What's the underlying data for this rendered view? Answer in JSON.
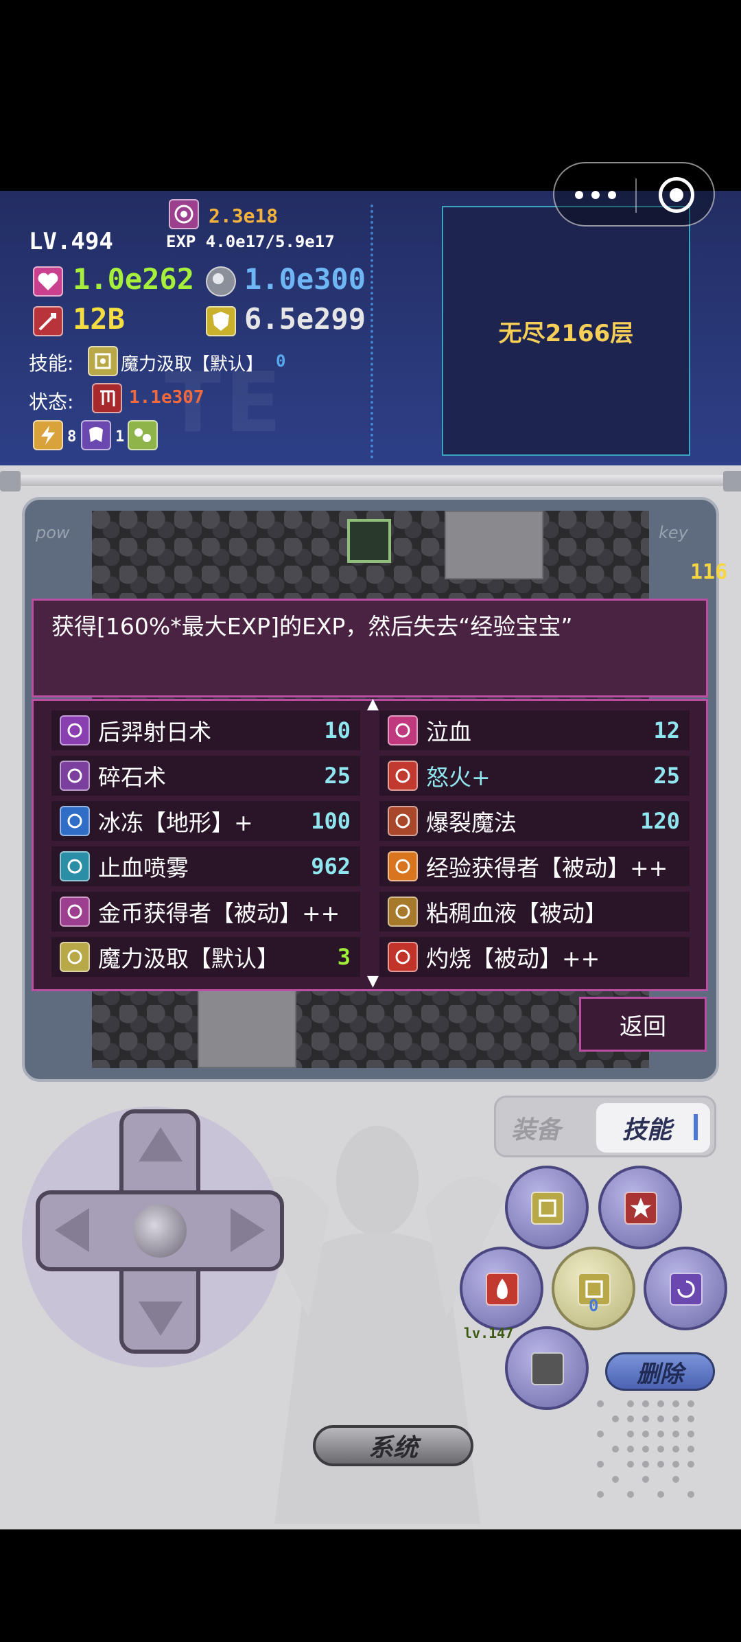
{
  "hud": {
    "level": "LV.494",
    "exp": "EXP 4.0e17/5.9e17",
    "gold": "2.3e18",
    "hp": "1.0e262",
    "defense": "1.0e300",
    "attack": "12B",
    "mdef": "6.5e299",
    "skill_label": "技能:",
    "skill_name": "魔力汲取【默认】",
    "skill_count": "0",
    "status_label": "状态:",
    "status_value": "1.1e307",
    "badge_a": "8",
    "badge_b": "1",
    "watermark": "TE",
    "floor": "无尽2166层"
  },
  "board": {
    "pow_label": "pow",
    "key_label": "key",
    "key_count": "116"
  },
  "description": "获得[160%*最大EXP]的EXP，然后失去“经验宝宝”",
  "skills": [
    {
      "name": "后羿射日术",
      "value": "10",
      "icon": "arrow-skill-icon",
      "color": "#8a3fb0"
    },
    {
      "name": "泣血",
      "value": "12",
      "icon": "blood-drop-icon",
      "color": "#c0397e"
    },
    {
      "name": "碎石术",
      "value": "25",
      "icon": "rock-shatter-icon",
      "color": "#7b3f9e"
    },
    {
      "name": "怒火+",
      "value": "25",
      "icon": "flame-icon",
      "color": "#c23a2f"
    },
    {
      "name": "冰冻【地形】+",
      "value": "100",
      "icon": "snowflake-icon",
      "color": "#2f6dc6"
    },
    {
      "name": "爆裂魔法",
      "value": "120",
      "icon": "explosion-icon",
      "color": "#a9472b"
    },
    {
      "name": "止血喷雾",
      "value": "962",
      "icon": "spray-icon",
      "color": "#2a8fa6"
    },
    {
      "name": "经验获得者【被动】++",
      "value": "",
      "icon": "exp-icon",
      "color": "#d9741f"
    },
    {
      "name": "金币获得者【被动】++",
      "value": "",
      "icon": "coin-spiral-icon",
      "color": "#9b3f8e"
    },
    {
      "name": "粘稠血液【被动】",
      "value": "",
      "icon": "blood-swirl-icon",
      "color": "#a67a2a"
    },
    {
      "name": "魔力汲取【默认】",
      "value": "3",
      "icon": "mana-drain-icon",
      "color": "#b8a848"
    },
    {
      "name": "灼烧【被动】++",
      "value": "",
      "icon": "burn-icon",
      "color": "#c2342a"
    }
  ],
  "back_button": "返回",
  "tabs": {
    "equip": "装备",
    "skill": "技能"
  },
  "quick": {
    "level": "lv.147",
    "mana_count": "0"
  },
  "delete_button": "删除",
  "system_button": "系统"
}
